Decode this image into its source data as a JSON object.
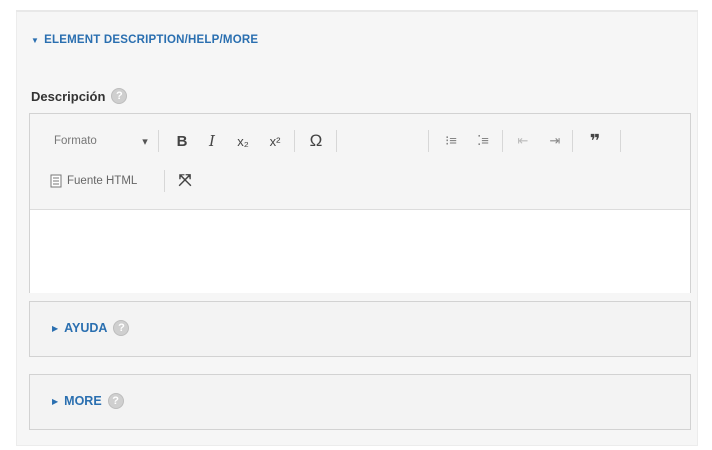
{
  "section": {
    "title": "ELEMENT DESCRIPTION/HELP/MORE"
  },
  "description": {
    "label": "Descripción",
    "help": "?"
  },
  "toolbar": {
    "format_label": "Formato",
    "format_caret": "▾",
    "bold": "B",
    "italic": "I",
    "subscript": "x₂",
    "superscript": "x²",
    "special_char": "Ω",
    "numbered_list": "⁝≡",
    "bullet_list": "⁚≡",
    "outdent": "⇤",
    "indent": "⇥",
    "blockquote": "❞",
    "source_label": "Fuente HTML",
    "maximize": "⤧"
  },
  "editor": {
    "content": ""
  },
  "ayuda": {
    "title": "AYUDA",
    "help": "?"
  },
  "more": {
    "title": "MORE",
    "help": "?"
  }
}
